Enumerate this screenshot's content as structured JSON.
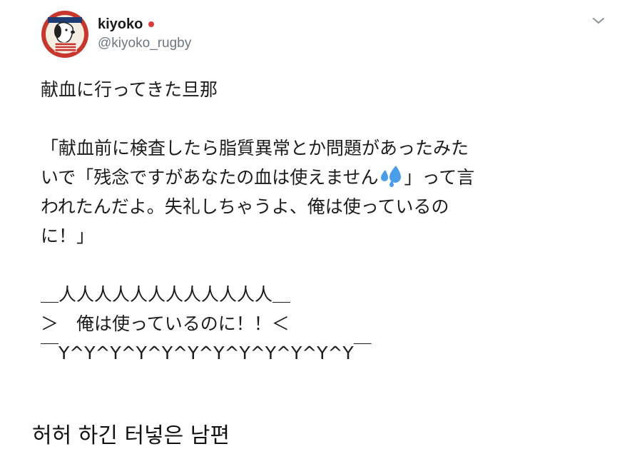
{
  "tweet": {
    "display_name": "kiyoko",
    "flag_icon": "japan-flag-icon",
    "handle": "@kiyoko_rugby",
    "menu_icon": "chevron-down-icon",
    "avatar_icon": "snoopy-avatar-icon",
    "lines": [
      "献血に行ってきた旦那",
      "",
      "「献血前に検査したら脂質異常とか問題があったみた",
      "いで「残念ですがあなたの血は使えません",
      "われたんだよ。失礼しちゃうよ、俺は使っているの",
      "に！」",
      "",
      "＿人人人人人人人人人人人人＿",
      "＞　俺は使っているのに！！＜",
      "￣Y^Y^Y^Y^Y^Y^Y^Y^Y^Y^Y^Y￣"
    ],
    "line4_suffix": "」って言",
    "emoji_icon": "sweat-droplets-icon"
  },
  "caption": {
    "text": "허허 하긴 터넣은 남편"
  },
  "colors": {
    "text": "#1c1c1c",
    "handle": "#6e7780",
    "flag_red": "#d93b3b",
    "emoji_blue": "#4a9ee8"
  }
}
